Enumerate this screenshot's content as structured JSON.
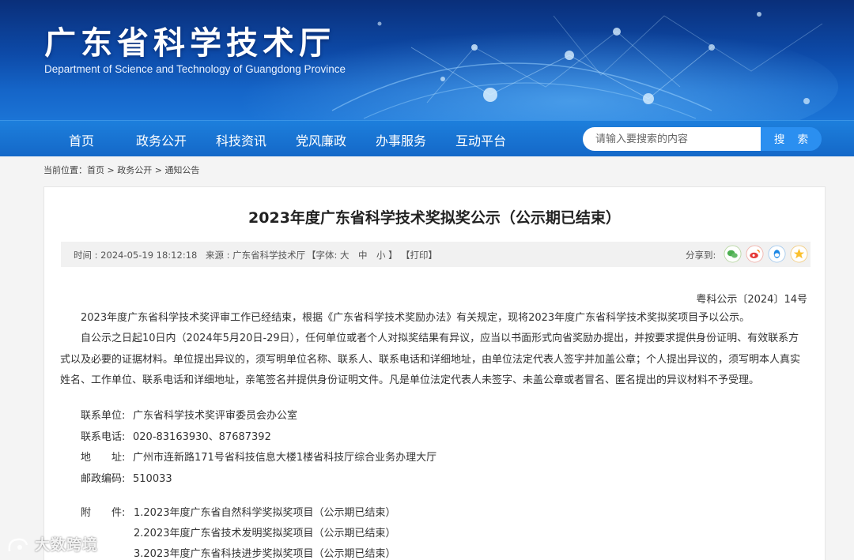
{
  "header": {
    "site_title": "广东省科学技术厅",
    "site_subtitle": "Department of Science and Technology of Guangdong Province"
  },
  "nav": {
    "items": [
      {
        "label": "首页"
      },
      {
        "label": "政务公开"
      },
      {
        "label": "科技资讯"
      },
      {
        "label": "党风廉政"
      },
      {
        "label": "办事服务"
      },
      {
        "label": "互动平台"
      }
    ],
    "search_placeholder": "请输入要搜索的内容",
    "search_button": "搜 索"
  },
  "breadcrumb": {
    "prefix": "当前位置：",
    "items": [
      "首页",
      "政务公开",
      "通知公告"
    ],
    "separator": " > "
  },
  "article": {
    "title": "2023年度广东省科学技术奖拟奖公示（公示期已结束）",
    "meta_time": "时间 : 2024-05-19 18:12:18",
    "meta_source": "来源 : 广东省科学技术厅",
    "font_size_label": "【字体: 大　中　小 】",
    "print_label": "【打印】",
    "share_label": "分享到:",
    "share_icons": [
      "wechat-icon",
      "weibo-icon",
      "qq-icon",
      "qzone-icon"
    ],
    "doc_number": "粤科公示〔2024〕14号",
    "paragraph_1": "2023年度广东省科学技术奖评审工作已经结束，根据《广东省科学技术奖励办法》有关规定，现将2023年度广东省科学技术奖拟奖项目予以公示。",
    "paragraph_2": "自公示之日起10日内（2024年5月20日-29日），任何单位或者个人对拟奖结果有异议，应当以书面形式向省奖励办提出，并按要求提供身份证明、有效联系方式以及必要的证据材料。单位提出异议的，须写明单位名称、联系人、联系电话和详细地址，由单位法定代表人签字并加盖公章；个人提出异议的，须写明本人真实姓名、工作单位、联系电话和详细地址，亲笔签名并提供身份证明文件。凡是单位法定代表人未签字、未盖公章或者冒名、匿名提出的异议材料不予受理。",
    "contacts": [
      {
        "label": "联系单位:",
        "value": "广东省科学技术奖评审委员会办公室"
      },
      {
        "label": "联系电话:",
        "value": "020-83163930、87687392"
      },
      {
        "label": "地　　址:",
        "value": "广州市连新路171号省科技信息大楼1楼省科技厅综合业务办理大厅"
      },
      {
        "label": "邮政编码:",
        "value": "510033"
      }
    ],
    "attachment_label": "附　　件:",
    "attachments": [
      "1.2023年度广东省自然科学奖拟奖项目（公示期已结束）",
      "2.2023年度广东省技术发明奖拟奖项目（公示期已结束）",
      "3.2023年度广东省科技进步奖拟奖项目（公示期已结束）"
    ]
  },
  "watermark": {
    "text": "大数跨境"
  },
  "colors": {
    "nav_bg": "#1468c8",
    "banner_dark": "#0a2f7a",
    "search_button": "#2b8ff0",
    "meta_bg": "#f1f1f1"
  }
}
